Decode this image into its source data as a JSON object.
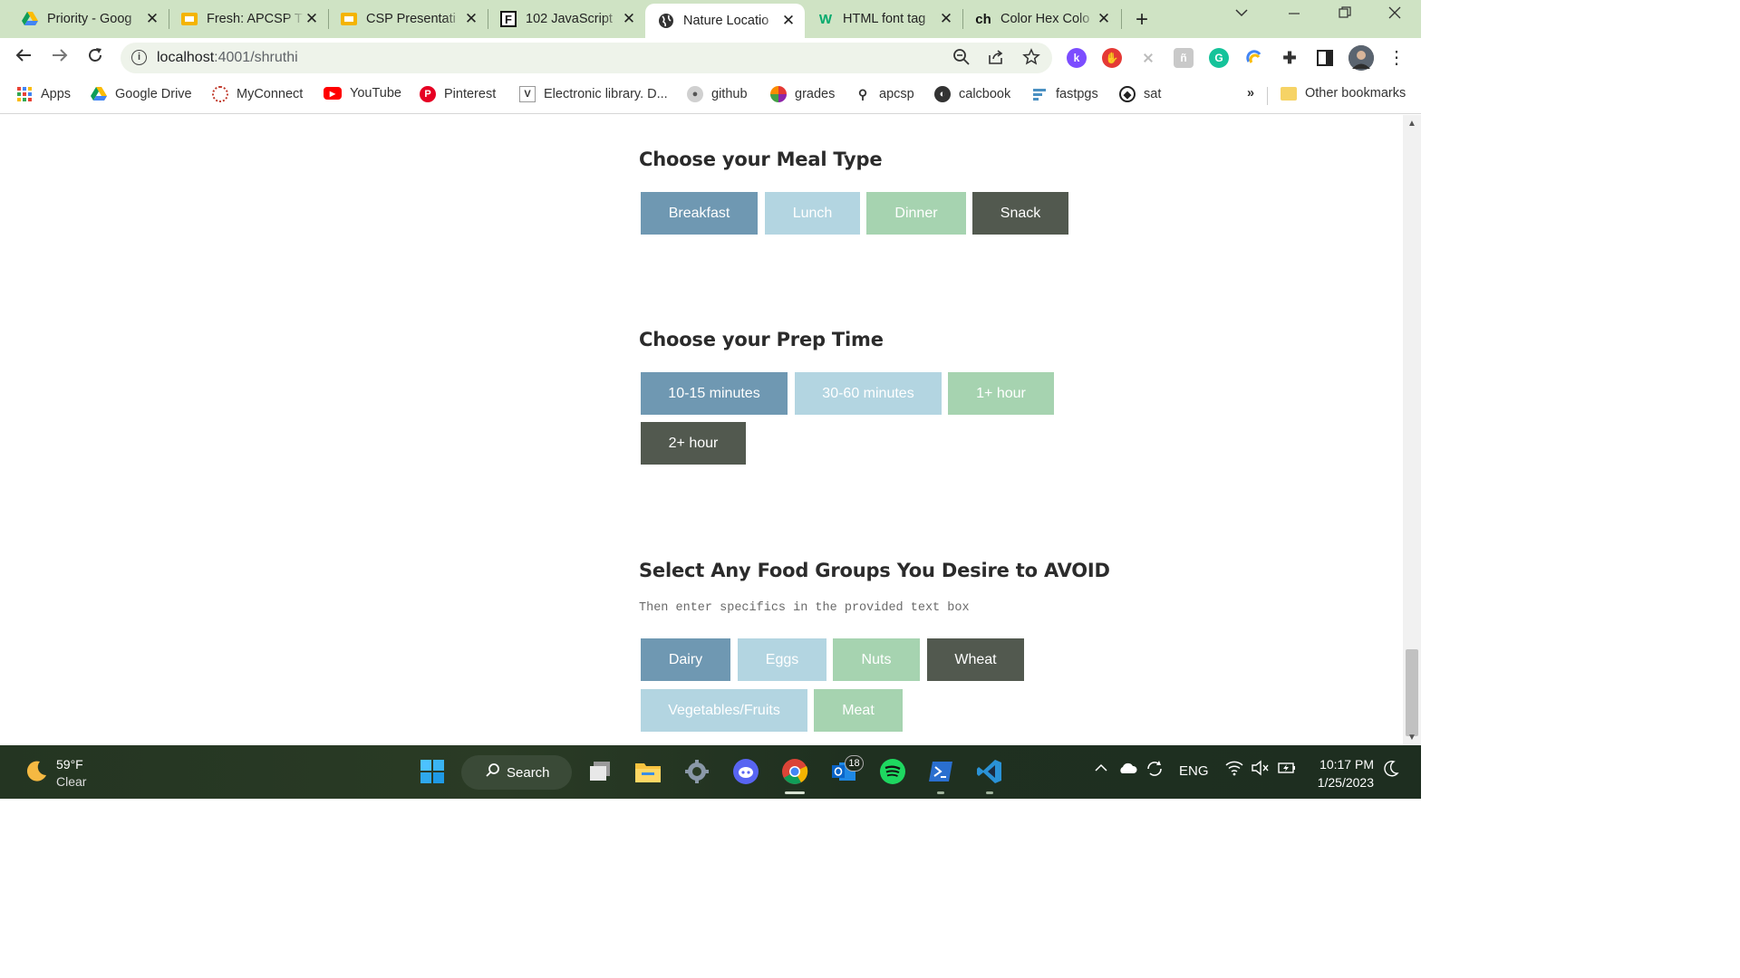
{
  "browser": {
    "tabs": [
      {
        "title": "Priority - Goog",
        "icon": "google-drive-icon"
      },
      {
        "title": "Fresh: APCSP T",
        "icon": "slides-icon"
      },
      {
        "title": "CSP Presentati",
        "icon": "slides-icon"
      },
      {
        "title": "102 JavaScript",
        "icon": "f-icon"
      },
      {
        "title": "Nature Locatio",
        "icon": "globe-icon"
      },
      {
        "title": "HTML font tag",
        "icon": "w3-icon"
      },
      {
        "title": "Color Hex Colo",
        "icon": "ch-icon"
      }
    ],
    "url_host": "localhost",
    "url_rest": ":4001/shruthi",
    "bookmarks": [
      {
        "label": "Apps"
      },
      {
        "label": "Google Drive"
      },
      {
        "label": "MyConnect"
      },
      {
        "label": "YouTube"
      },
      {
        "label": "Pinterest"
      },
      {
        "label": "Electronic library. D..."
      },
      {
        "label": "github"
      },
      {
        "label": "grades"
      },
      {
        "label": "apcsp"
      },
      {
        "label": "calcbook"
      },
      {
        "label": "fastpgs"
      },
      {
        "label": "sat"
      }
    ],
    "bookmarks_overflow": "»",
    "other_bookmarks": "Other bookmarks"
  },
  "page": {
    "meal_type": {
      "title": "Choose your Meal Type",
      "options": [
        "Breakfast",
        "Lunch",
        "Dinner",
        "Snack"
      ]
    },
    "prep_time": {
      "title": "Choose your Prep Time",
      "options": [
        "10-15 minutes",
        "30-60 minutes",
        "1+ hour",
        "2+ hour"
      ]
    },
    "avoid": {
      "title": "Select Any Food Groups You Desire to AVOID",
      "subtitle": "Then enter specifics in the provided text box",
      "options": [
        "Dairy",
        "Eggs",
        "Nuts",
        "Wheat",
        "Vegetables/Fruits",
        "Meat"
      ]
    },
    "colors": {
      "blue": "#6f98b2",
      "light_blue": "#b3d5e1",
      "green": "#a6d3b0",
      "dark": "#52594f"
    }
  },
  "taskbar": {
    "temperature": "59°F",
    "condition": "Clear",
    "search_label": "Search",
    "notification_badge": "18",
    "language": "ENG",
    "time": "10:17 PM",
    "date": "1/25/2023"
  }
}
